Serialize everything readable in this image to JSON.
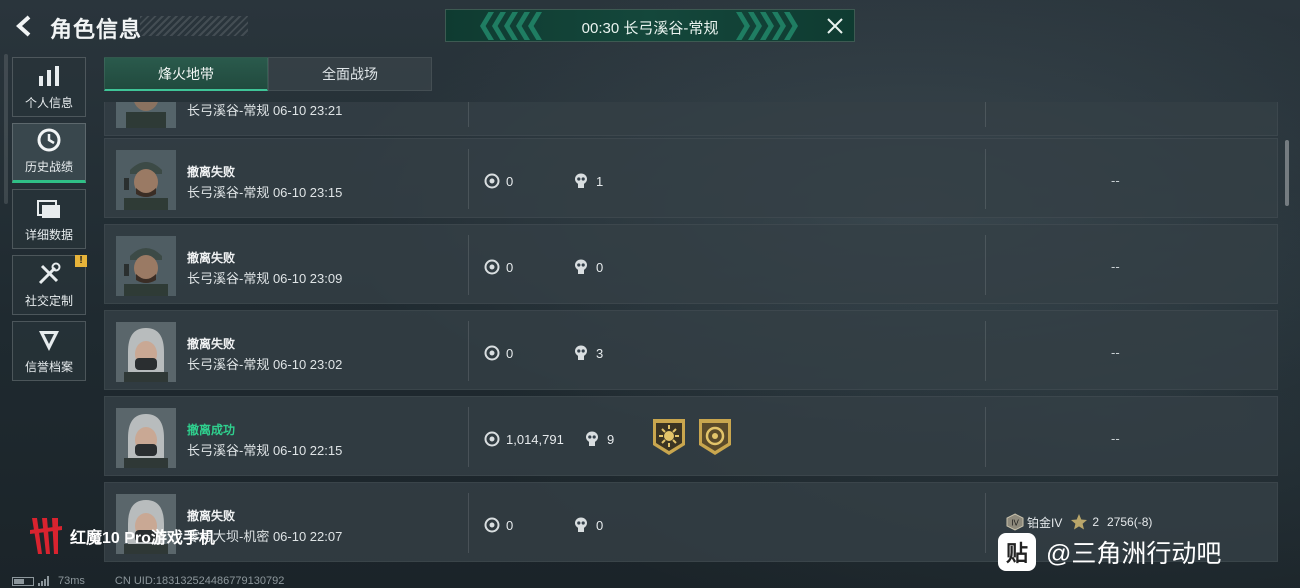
{
  "header": {
    "title": "角色信息",
    "match_banner": "00:30  长弓溪谷-常规"
  },
  "sidebar": {
    "items": [
      {
        "label": "个人信息",
        "icon": "bar-chart-icon"
      },
      {
        "label": "历史战绩",
        "icon": "clock-icon",
        "active": true
      },
      {
        "label": "详细数据",
        "icon": "folder-icon"
      },
      {
        "label": "社交定制",
        "icon": "tools-icon",
        "badge": "!"
      },
      {
        "label": "信誉档案",
        "icon": "shield-badge-icon"
      }
    ]
  },
  "tabs": [
    {
      "label": "烽火地带",
      "active": true
    },
    {
      "label": "全面战场",
      "active": false
    }
  ],
  "records": [
    {
      "status": "",
      "meta": "长弓溪谷-常规 06-10 23:21",
      "coins": "",
      "kills": "",
      "result": ""
    },
    {
      "status": "撤离失败",
      "meta": "长弓溪谷-常规 06-10 23:15",
      "coins": "0",
      "kills": "1",
      "result": "--"
    },
    {
      "status": "撤离失败",
      "meta": "长弓溪谷-常规 06-10 23:09",
      "coins": "0",
      "kills": "0",
      "result": "--"
    },
    {
      "status": "撤离失败",
      "meta": "长弓溪谷-常规 06-10 23:02",
      "coins": "0",
      "kills": "3",
      "result": "--"
    },
    {
      "status": "撤离成功",
      "meta": "长弓溪谷-常规 06-10 22:15",
      "coins": "1,014,791",
      "kills": "9",
      "result": "--"
    },
    {
      "status": "撤离失败",
      "meta": "零号大坝-机密 06-10 22:07",
      "coins": "0",
      "kills": "0",
      "rank": "铂金IV",
      "stars": "2",
      "score": "2756(-8)"
    }
  ],
  "colors": {
    "accent": "#2fbf86",
    "success": "#2fd08e",
    "banner": "#14473b",
    "warning": "#e7b43a"
  },
  "watermark": {
    "brand": "红魔10 Pro游戏手机",
    "tieba": "@三角洲行动吧",
    "tieba_icon": "贴"
  },
  "footer": {
    "ping": "73ms",
    "uid": "CN UID:183132524486779130792"
  }
}
